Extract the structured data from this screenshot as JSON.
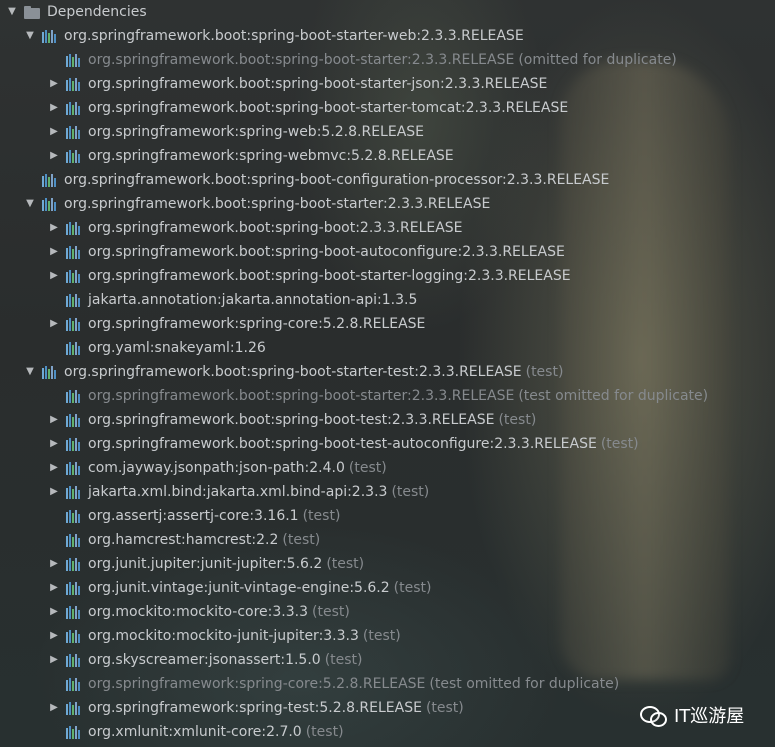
{
  "root": {
    "label": "Dependencies"
  },
  "rows": [
    {
      "label": "org.springframework.boot:spring-boot-starter-web:2.3.3.RELEASE",
      "suffix": "",
      "level": 1,
      "arrow": "down",
      "dim": false
    },
    {
      "label": "org.springframework.boot:spring-boot-starter:2.3.3.RELEASE",
      "suffix": "(omitted for duplicate)",
      "level": 2,
      "arrow": "none",
      "dim": true
    },
    {
      "label": "org.springframework.boot:spring-boot-starter-json:2.3.3.RELEASE",
      "suffix": "",
      "level": 2,
      "arrow": "right",
      "dim": false
    },
    {
      "label": "org.springframework.boot:spring-boot-starter-tomcat:2.3.3.RELEASE",
      "suffix": "",
      "level": 2,
      "arrow": "right",
      "dim": false
    },
    {
      "label": "org.springframework:spring-web:5.2.8.RELEASE",
      "suffix": "",
      "level": 2,
      "arrow": "right",
      "dim": false
    },
    {
      "label": "org.springframework:spring-webmvc:5.2.8.RELEASE",
      "suffix": "",
      "level": 2,
      "arrow": "right",
      "dim": false
    },
    {
      "label": "org.springframework.boot:spring-boot-configuration-processor:2.3.3.RELEASE",
      "suffix": "",
      "level": 1,
      "arrow": "none",
      "dim": false
    },
    {
      "label": "org.springframework.boot:spring-boot-starter:2.3.3.RELEASE",
      "suffix": "",
      "level": 1,
      "arrow": "down",
      "dim": false
    },
    {
      "label": "org.springframework.boot:spring-boot:2.3.3.RELEASE",
      "suffix": "",
      "level": 2,
      "arrow": "right",
      "dim": false
    },
    {
      "label": "org.springframework.boot:spring-boot-autoconfigure:2.3.3.RELEASE",
      "suffix": "",
      "level": 2,
      "arrow": "right",
      "dim": false
    },
    {
      "label": "org.springframework.boot:spring-boot-starter-logging:2.3.3.RELEASE",
      "suffix": "",
      "level": 2,
      "arrow": "right",
      "dim": false
    },
    {
      "label": "jakarta.annotation:jakarta.annotation-api:1.3.5",
      "suffix": "",
      "level": 2,
      "arrow": "none",
      "dim": false
    },
    {
      "label": "org.springframework:spring-core:5.2.8.RELEASE",
      "suffix": "",
      "level": 2,
      "arrow": "right",
      "dim": false
    },
    {
      "label": "org.yaml:snakeyaml:1.26",
      "suffix": "",
      "level": 2,
      "arrow": "none",
      "dim": false
    },
    {
      "label": "org.springframework.boot:spring-boot-starter-test:2.3.3.RELEASE",
      "suffix": "(test)",
      "level": 1,
      "arrow": "down",
      "dim": false
    },
    {
      "label": "org.springframework.boot:spring-boot-starter:2.3.3.RELEASE",
      "suffix": "(test omitted for duplicate)",
      "level": 2,
      "arrow": "none",
      "dim": true
    },
    {
      "label": "org.springframework.boot:spring-boot-test:2.3.3.RELEASE",
      "suffix": "(test)",
      "level": 2,
      "arrow": "right",
      "dim": false
    },
    {
      "label": "org.springframework.boot:spring-boot-test-autoconfigure:2.3.3.RELEASE",
      "suffix": "(test)",
      "level": 2,
      "arrow": "right",
      "dim": false
    },
    {
      "label": "com.jayway.jsonpath:json-path:2.4.0",
      "suffix": "(test)",
      "level": 2,
      "arrow": "right",
      "dim": false
    },
    {
      "label": "jakarta.xml.bind:jakarta.xml.bind-api:2.3.3",
      "suffix": "(test)",
      "level": 2,
      "arrow": "right",
      "dim": false
    },
    {
      "label": "org.assertj:assertj-core:3.16.1",
      "suffix": "(test)",
      "level": 2,
      "arrow": "none",
      "dim": false
    },
    {
      "label": "org.hamcrest:hamcrest:2.2",
      "suffix": "(test)",
      "level": 2,
      "arrow": "none",
      "dim": false
    },
    {
      "label": "org.junit.jupiter:junit-jupiter:5.6.2",
      "suffix": "(test)",
      "level": 2,
      "arrow": "right",
      "dim": false
    },
    {
      "label": "org.junit.vintage:junit-vintage-engine:5.6.2",
      "suffix": "(test)",
      "level": 2,
      "arrow": "right",
      "dim": false
    },
    {
      "label": "org.mockito:mockito-core:3.3.3",
      "suffix": "(test)",
      "level": 2,
      "arrow": "right",
      "dim": false
    },
    {
      "label": "org.mockito:mockito-junit-jupiter:3.3.3",
      "suffix": "(test)",
      "level": 2,
      "arrow": "right",
      "dim": false
    },
    {
      "label": "org.skyscreamer:jsonassert:1.5.0",
      "suffix": "(test)",
      "level": 2,
      "arrow": "right",
      "dim": false
    },
    {
      "label": "org.springframework:spring-core:5.2.8.RELEASE",
      "suffix": "(test omitted for duplicate)",
      "level": 2,
      "arrow": "none",
      "dim": true
    },
    {
      "label": "org.springframework:spring-test:5.2.8.RELEASE",
      "suffix": "(test)",
      "level": 2,
      "arrow": "right",
      "dim": false
    },
    {
      "label": "org.xmlunit:xmlunit-core:2.7.0",
      "suffix": "(test)",
      "level": 2,
      "arrow": "none",
      "dim": false
    }
  ],
  "icons": {
    "expanded": "chevron-down-icon",
    "collapsed": "chevron-right-icon",
    "library": "library-icon",
    "folder": "folder-icon"
  },
  "watermark": {
    "text": "IT巡游屋",
    "icon": "wechat-icon"
  }
}
